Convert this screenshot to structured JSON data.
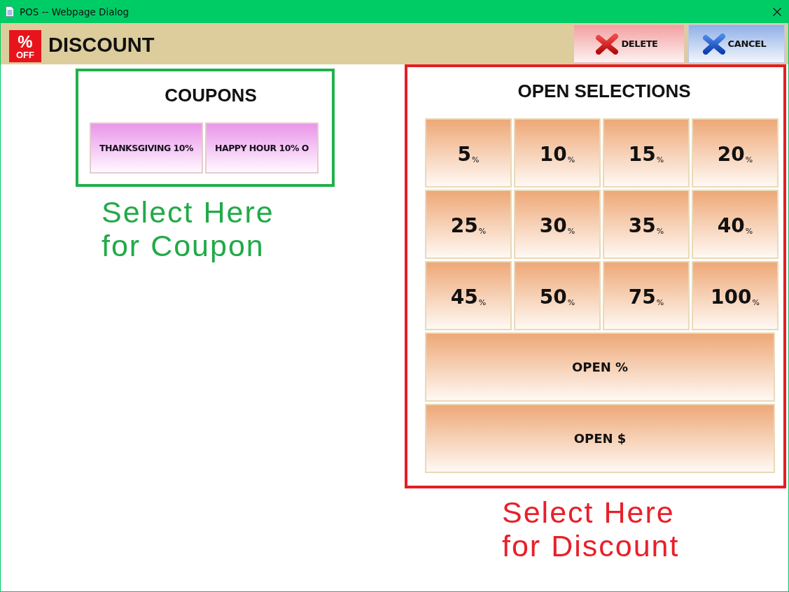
{
  "window": {
    "title": "POS -- Webpage Dialog"
  },
  "header": {
    "logo": {
      "symbol": "%",
      "caption": "OFF"
    },
    "title": "DISCOUNT",
    "actions": [
      {
        "kind": "delete",
        "label": "DELETE"
      },
      {
        "kind": "cancel",
        "label": "CANCEL"
      }
    ]
  },
  "coupons": {
    "title": "COUPONS",
    "items": [
      "THANKSGIVING 10%",
      "HAPPY HOUR 10% O"
    ],
    "annotation": [
      "Select Here",
      "for Coupon"
    ]
  },
  "open_selections": {
    "title": "OPEN SELECTIONS",
    "percent_buttons": [
      {
        "amount": "5",
        "unit": "%"
      },
      {
        "amount": "10",
        "unit": "%"
      },
      {
        "amount": "15",
        "unit": "%"
      },
      {
        "amount": "20",
        "unit": "%"
      },
      {
        "amount": "25",
        "unit": "%"
      },
      {
        "amount": "30",
        "unit": "%"
      },
      {
        "amount": "35",
        "unit": "%"
      },
      {
        "amount": "40",
        "unit": "%"
      },
      {
        "amount": "45",
        "unit": "%"
      },
      {
        "amount": "50",
        "unit": "%"
      },
      {
        "amount": "75",
        "unit": "%"
      },
      {
        "amount": "100",
        "unit": "%"
      }
    ],
    "open_buttons": [
      "OPEN %",
      "OPEN $"
    ],
    "annotation": [
      "Select Here",
      "for Discount"
    ]
  }
}
